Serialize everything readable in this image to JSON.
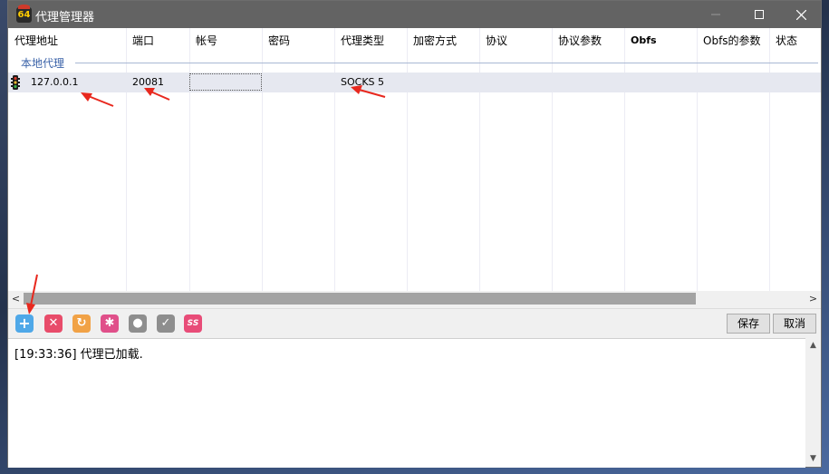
{
  "window": {
    "title": "代理管理器",
    "icon_text": "64"
  },
  "columns": [
    "代理地址",
    "端口",
    "帐号",
    "密码",
    "代理类型",
    "加密方式",
    "协议",
    "协议参数",
    "Obfs",
    "Obfs的参数",
    "状态"
  ],
  "group": {
    "label": "本地代理"
  },
  "rows": [
    {
      "address": "127.0.0.1",
      "port": "20081",
      "account": "",
      "password": "",
      "type": "SOCKS 5",
      "encryption": "",
      "protocol": "",
      "protocol_params": "",
      "obfs": "",
      "obfs_params": "",
      "status": ""
    }
  ],
  "scrollbar": {
    "left": "<",
    "right": ">"
  },
  "toolbar": {
    "add": "+",
    "delete": "✕",
    "refresh": "↻",
    "settings": "✱",
    "bulb": "●",
    "check": "✓",
    "ss": "SS",
    "save_label": "保存",
    "cancel_label": "取消"
  },
  "log": {
    "entries": [
      "[19:33:36]  代理已加载."
    ]
  },
  "icons": {
    "app": "proxy-app-icon",
    "row": "traffic-light-icon",
    "add": "plus-icon",
    "delete": "x-icon",
    "refresh": "refresh-icon",
    "settings": "gear-icon",
    "bulb": "lightbulb-icon",
    "check": "check-icon",
    "ss": "ss-icon"
  },
  "colors": {
    "titlebar": "#636363",
    "group_label": "#3a62a8",
    "row_bg": "#e6e8f0",
    "annotation_arrow": "#e8281e"
  }
}
